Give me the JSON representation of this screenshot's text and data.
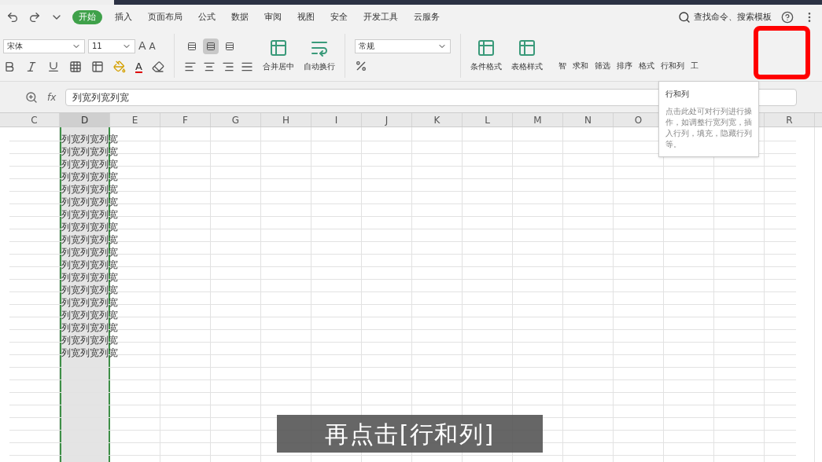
{
  "quick_access": {
    "search": "查找命令、搜索模板"
  },
  "tabs": [
    {
      "label": "开始",
      "selected": true
    },
    {
      "label": "插入",
      "selected": false
    },
    {
      "label": "页面布局",
      "selected": false
    },
    {
      "label": "公式",
      "selected": false
    },
    {
      "label": "数据",
      "selected": false
    },
    {
      "label": "审阅",
      "selected": false
    },
    {
      "label": "视图",
      "selected": false
    },
    {
      "label": "安全",
      "selected": false
    },
    {
      "label": "开发工具",
      "selected": false
    },
    {
      "label": "云服务",
      "selected": false
    }
  ],
  "ribbon": {
    "font_name": "宋体",
    "font_size": "11",
    "vertical_align": [
      {
        "selected": false
      },
      {
        "selected": true
      },
      {
        "selected": false
      }
    ],
    "grow_font": "A",
    "shrink_font": "A",
    "font_color": "A",
    "big_buttons": [
      {
        "label": "合并居中"
      },
      {
        "label": "自动换行"
      }
    ],
    "number_format": "常规",
    "style_buttons": [
      {
        "label": "条件格式"
      },
      {
        "label": "表格样式"
      }
    ],
    "small_buttons": [
      {
        "label": "智"
      },
      {
        "label": "求和"
      },
      {
        "label": "筛选"
      },
      {
        "label": "排序"
      },
      {
        "label": "格式"
      },
      {
        "label": "行和列"
      },
      {
        "label": "工"
      }
    ]
  },
  "formula_bar": {
    "fx": "fx",
    "value": "列宽列宽列宽"
  },
  "columns": [
    {
      "label": "C",
      "selected": false
    },
    {
      "label": "D",
      "selected": true
    },
    {
      "label": "E",
      "selected": false
    },
    {
      "label": "F",
      "selected": false
    },
    {
      "label": "G",
      "selected": false
    },
    {
      "label": "H",
      "selected": false
    },
    {
      "label": "I",
      "selected": false
    },
    {
      "label": "J",
      "selected": false
    },
    {
      "label": "K",
      "selected": false
    },
    {
      "label": "L",
      "selected": false
    },
    {
      "label": "M",
      "selected": false
    },
    {
      "label": "N",
      "selected": false
    },
    {
      "label": "O",
      "selected": false
    },
    {
      "label": "R",
      "selected": false
    }
  ],
  "rows": [
    "列宽列宽列宽",
    "列宽列宽列宽",
    "列宽列宽列宽",
    "列宽列宽列宽",
    "列宽列宽列宽",
    "列宽列宽列宽",
    "列宽列宽列宽",
    "列宽列宽列宽",
    "列宽列宽列宽",
    "列宽列宽列宽",
    "列宽列宽列宽",
    "列宽列宽列宽",
    "列宽列宽列宽",
    "列宽列宽列宽",
    "列宽列宽列宽",
    "列宽列宽列宽",
    "列宽列宽列宽",
    "列宽列宽列宽"
  ],
  "tooltip": {
    "title": "行和列",
    "body": "点击此处可对行列进行操作，如调整行宽列宽，插入行列，填充，隐藏行列等。"
  },
  "subtitle": "再点击[行和列]"
}
